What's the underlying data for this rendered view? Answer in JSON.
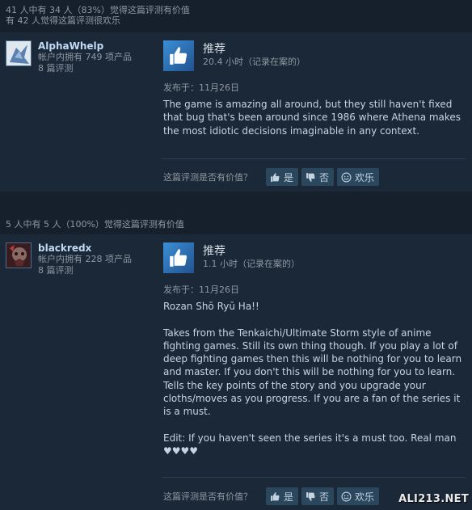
{
  "reviews": [
    {
      "helpful_line1": "41 人中有 34 人（83%）觉得这篇评测有价值",
      "helpful_line2": "有 42 人觉得这篇评测很欢乐",
      "author_name": "AlphaWhelp",
      "products_owned": "帐户内拥有 749 项产品",
      "review_count": "8 篇评测",
      "recommendation": "推荐",
      "hours": "20.4 小时（记录在案的）",
      "posted": "发布于：11月26日",
      "text": "The game is amazing all around, but they still haven't fixed that bug that's been around since 1986 where Athena makes the most idiotic decisions imaginable in any context.",
      "vote_prompt": "这篇评测是否有价值？",
      "vote_yes": "是",
      "vote_no": "否",
      "vote_funny": "欢乐"
    },
    {
      "helpful_line1": "5 人中有 5 人（100%）觉得这篇评测有价值",
      "author_name": "blackredx",
      "products_owned": "帐户内拥有 228 项产品",
      "review_count": "8 篇评测",
      "recommendation": "推荐",
      "hours": "1.1 小时（记录在案的）",
      "posted": "发布于：11月26日",
      "text": "Rozan Shō Ryū Ha!!\n\nTakes from the Tenkaichi/Ultimate Storm style of anime fighting games. Still its own thing though. If you play a lot of deep fighting games then this will be nothing for you to learn and master. If you don't this will be nothing for you to learn. Tells the key points of the story and you upgrade your cloths/moves as you progress. If you are a fan of the series it is a must.\n\nEdit: If you haven't seen the series it's a must too. Real man ♥♥♥♥",
      "vote_prompt": "这篇评测是否有价值？",
      "vote_yes": "是",
      "vote_no": "否",
      "vote_funny": "欢乐"
    }
  ],
  "watermark": "ALI213.NET",
  "colors": {
    "background": "#1b2838",
    "header_bg": "#16202d",
    "thumb_blue": "#3a8fd6",
    "author_name": "#c1dbf4",
    "vote_button": "#2a475e"
  },
  "icons": {
    "thumbs_up": "thumbs-up-icon",
    "thumbs_down": "thumbs-down-icon",
    "smiley": "smiley-icon"
  }
}
